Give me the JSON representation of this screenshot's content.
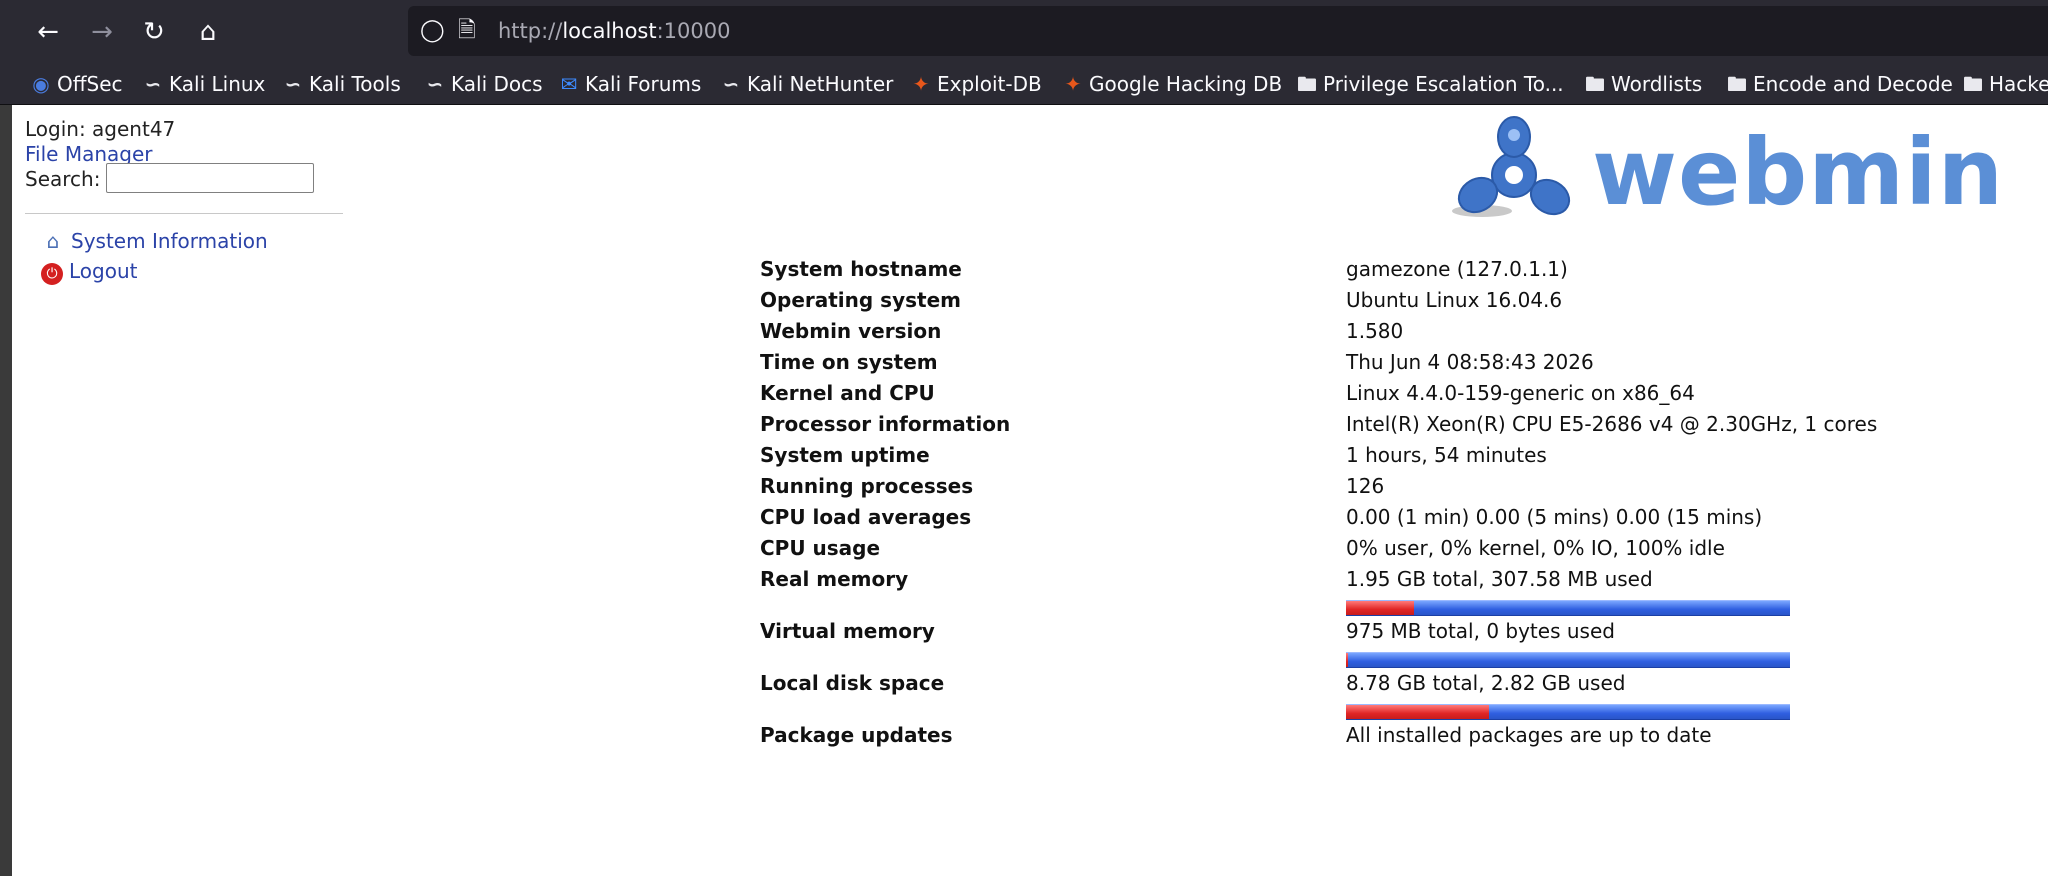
{
  "browser": {
    "url_prefix": "http://",
    "url_host": "localhost",
    "url_port": ":10000",
    "icons": {
      "back": "arrow-left-icon",
      "forward": "arrow-right-icon",
      "reload": "reload-icon",
      "home": "home-icon",
      "shield": "shield-icon",
      "page": "page-icon"
    }
  },
  "bookmarks": [
    {
      "label": "OffSec",
      "icon": "offsec-icon"
    },
    {
      "label": "Kali Linux",
      "icon": "kali-icon"
    },
    {
      "label": "Kali Tools",
      "icon": "kali-icon"
    },
    {
      "label": "Kali Docs",
      "icon": "kali-icon"
    },
    {
      "label": "Kali Forums",
      "icon": "forum-icon"
    },
    {
      "label": "Kali NetHunter",
      "icon": "kali-icon"
    },
    {
      "label": "Exploit-DB",
      "icon": "exploitdb-icon"
    },
    {
      "label": "Google Hacking DB",
      "icon": "exploitdb-icon"
    },
    {
      "label": "Privilege Escalation To...",
      "icon": "folder-icon"
    },
    {
      "label": "Wordlists",
      "icon": "folder-icon"
    },
    {
      "label": "Encode and Decode",
      "icon": "folder-icon"
    },
    {
      "label": "Hacke",
      "icon": "folder-icon"
    }
  ],
  "sidebar": {
    "login": "Login: agent47",
    "file_manager": "File Manager",
    "search_label": "Search:",
    "search_value": "",
    "items": [
      {
        "label": "System Information",
        "icon": "home-icon"
      },
      {
        "label": "Logout",
        "icon": "power-icon"
      }
    ]
  },
  "logo": {
    "text": "webmin"
  },
  "system_info": [
    {
      "label": "System hostname",
      "value": "gamezone (127.0.1.1)"
    },
    {
      "label": "Operating system",
      "value": "Ubuntu Linux 16.04.6"
    },
    {
      "label": "Webmin version",
      "value": "1.580"
    },
    {
      "label": "Time on system",
      "value": "Thu Jun 4 08:58:43 2026"
    },
    {
      "label": "Kernel and CPU",
      "value": "Linux 4.4.0-159-generic on x86_64"
    },
    {
      "label": "Processor information",
      "value": "Intel(R) Xeon(R) CPU E5-2686 v4 @ 2.30GHz, 1 cores"
    },
    {
      "label": "System uptime",
      "value": "1 hours, 54 minutes"
    },
    {
      "label": "Running processes",
      "value": "126"
    },
    {
      "label": "CPU load averages",
      "value": "0.00 (1 min) 0.00 (5 mins) 0.00 (15 mins)"
    },
    {
      "label": "CPU usage",
      "value": "0% user, 0% kernel, 0% IO, 100% idle"
    },
    {
      "label": "Real memory",
      "value": "1.95 GB total, 307.58 MB used",
      "usage_fraction": 0.154
    },
    {
      "label": "Virtual memory",
      "value": "975 MB total, 0 bytes used",
      "usage_fraction": 0.0
    },
    {
      "label": "Local disk space",
      "value": "8.78 GB total, 2.82 GB used",
      "usage_fraction": 0.321
    },
    {
      "label": "Package updates",
      "value": "All installed packages are up to date"
    }
  ],
  "colors": {
    "used": "#e02626",
    "free": "#2f5fe0",
    "link": "#2b43a8",
    "chrome": "#2b2a33"
  }
}
